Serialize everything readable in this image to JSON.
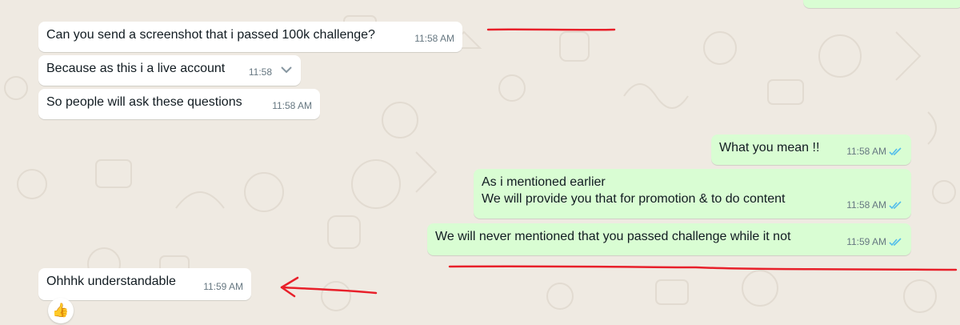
{
  "messages": [
    {
      "id": "m1",
      "direction": "incoming",
      "text": "Can you send a screenshot that i passed 100k challenge?",
      "time": "11:58 AM"
    },
    {
      "id": "m2",
      "direction": "incoming",
      "text": "Because as this i a live account",
      "time": "11:58"
    },
    {
      "id": "m3",
      "direction": "incoming",
      "text": "So people will ask these questions",
      "time": "11:58 AM"
    },
    {
      "id": "m4",
      "direction": "outgoing",
      "text": "What you mean !!",
      "time": "11:58 AM",
      "status": "read"
    },
    {
      "id": "m5",
      "direction": "outgoing",
      "line1": "As i mentioned earlier",
      "line2": "We will provide you that for promotion & to do content",
      "time": "11:58 AM",
      "status": "read"
    },
    {
      "id": "m6",
      "direction": "outgoing",
      "text": "We will never mentioned that you passed challenge while it not",
      "time": "11:59 AM",
      "status": "read"
    },
    {
      "id": "m7",
      "direction": "incoming",
      "text": "Ohhhk understandable",
      "time": "11:59 AM",
      "reaction": "👍"
    }
  ],
  "colors": {
    "background": "#efeae2",
    "incoming_bubble": "#ffffff",
    "outgoing_bubble": "#d9fdd3",
    "read_ticks": "#53bdeb",
    "annotation": "#e8202a"
  },
  "icons": [
    "double-check-icon",
    "chevron-down-icon",
    "thumbs-up-reaction-icon"
  ]
}
